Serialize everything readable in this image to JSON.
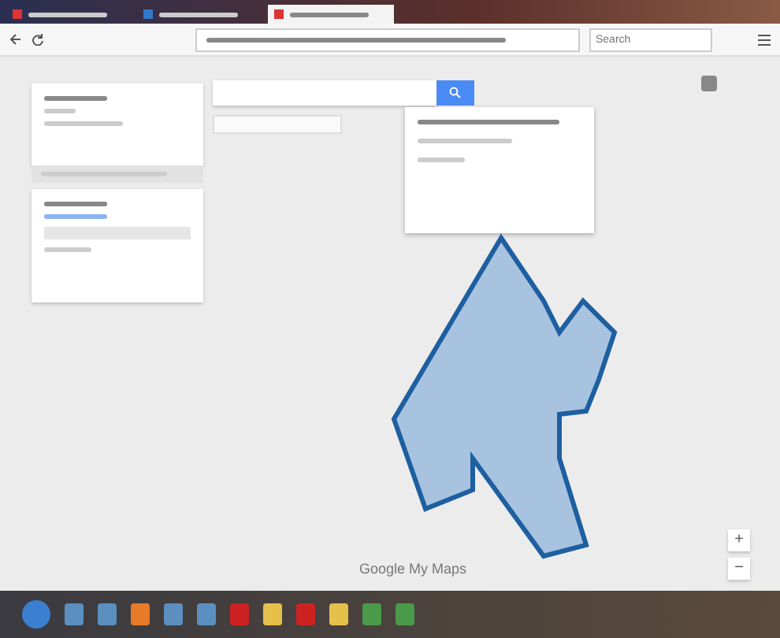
{
  "browser": {
    "tabs": [
      {
        "selected": false
      },
      {
        "selected": false
      },
      {
        "selected": true
      }
    ],
    "search": {
      "placeholder": "Search"
    }
  },
  "map": {
    "zoom_buttons": [
      "+",
      "−"
    ],
    "logo": "Google My Maps"
  }
}
